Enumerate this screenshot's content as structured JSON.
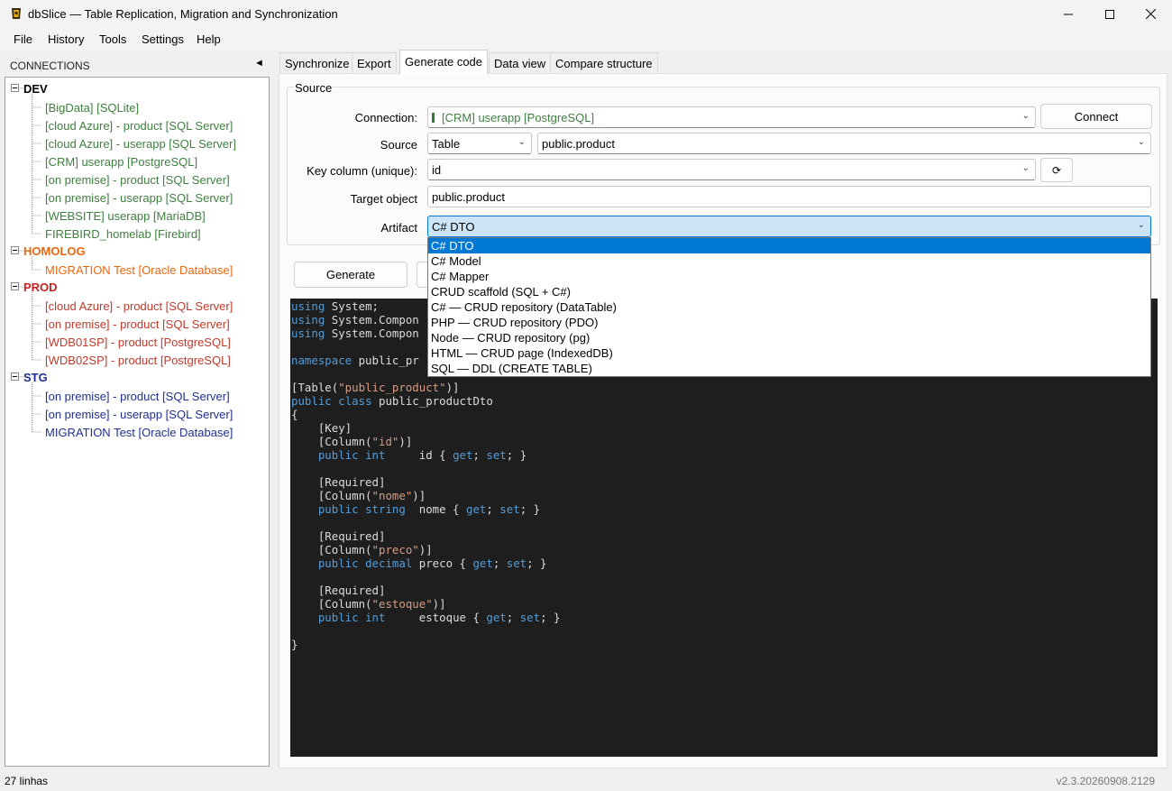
{
  "window": {
    "title": "dbSlice — Table Replication, Migration and Synchronization"
  },
  "menu": [
    "File",
    "History",
    "Tools",
    "Settings",
    "Help"
  ],
  "sidebar": {
    "header": "CONNECTIONS",
    "collapse_glyph": "◄",
    "groups": [
      {
        "label": "DEV",
        "color": "#000000",
        "item_color": "#3f7f3f",
        "items": [
          "[BigData]  [SQLite]",
          "[cloud Azure] - product  [SQL Server]",
          "[cloud Azure] - userapp  [SQL Server]",
          "[CRM] userapp  [PostgreSQL]",
          "[on premise] - product  [SQL Server]",
          "[on premise] - userapp  [SQL Server]",
          "[WEBSITE] userapp  [MariaDB]",
          "FIREBIRD_homelab  [Firebird]"
        ]
      },
      {
        "label": "HOMOLOG",
        "color": "#e8670f",
        "item_color": "#e8670f",
        "items": [
          "MIGRATION Test  [Oracle Database]"
        ]
      },
      {
        "label": "PROD",
        "color": "#cc2121",
        "item_color": "#c0392b",
        "items": [
          "[cloud Azure] - product  [SQL Server]",
          "[on premise] - product  [SQL Server]",
          "[WDB01SP] - product  [PostgreSQL]",
          "[WDB02SP] - product  [PostgreSQL]"
        ]
      },
      {
        "label": "STG",
        "color": "#1f2f8f",
        "item_color": "#1f2f8f",
        "items": [
          "[on premise] - product  [SQL Server]",
          "[on premise] - userapp  [SQL Server]",
          "MIGRATION Test  [Oracle Database]"
        ]
      }
    ]
  },
  "tabs": [
    "Synchronize",
    "Export",
    "Generate code",
    "Data view",
    "Compare structure"
  ],
  "active_tab": "Generate code",
  "source": {
    "group_title": "Source",
    "connection_label": "Connection:",
    "connection_value": "[CRM] userapp   [PostgreSQL]",
    "connect_button": "Connect",
    "source_label": "Source",
    "source_type": "Table",
    "source_object": "public.product",
    "key_label": "Key column (unique):",
    "key_value": "id",
    "refresh_glyph": "⟳",
    "target_label": "Target object",
    "target_value": "public.product",
    "artifact_label": "Artifact",
    "artifact_value": "C# DTO"
  },
  "artifact_options": [
    "C# DTO",
    "C# Model",
    "C# Mapper",
    "CRUD scaffold (SQL + C#)",
    "C# — CRUD repository (DataTable)",
    "PHP — CRUD repository (PDO)",
    "Node — CRUD repository (pg)",
    "HTML — CRUD page (IndexedDB)",
    "SQL — DDL (CREATE TABLE)"
  ],
  "generate_button": "Generate",
  "code_lines": [
    "using System;",
    "using System.Compon",
    "using System.Compon",
    "",
    "namespace public_pr",
    "",
    "[Table(\"public_product\")]",
    "public class public_productDto",
    "{",
    "    [Key]",
    "    [Column(\"id\")]",
    "    public int     id { get; set; }",
    "",
    "    [Required]",
    "    [Column(\"nome\")]",
    "    public string  nome { get; set; }",
    "",
    "    [Required]",
    "    [Column(\"preco\")]",
    "    public decimal preco { get; set; }",
    "",
    "    [Required]",
    "    [Column(\"estoque\")]",
    "    public int     estoque { get; set; }",
    "",
    "}"
  ],
  "status": {
    "left": "27 linhas",
    "right": "v2.3.20260908.2129"
  }
}
